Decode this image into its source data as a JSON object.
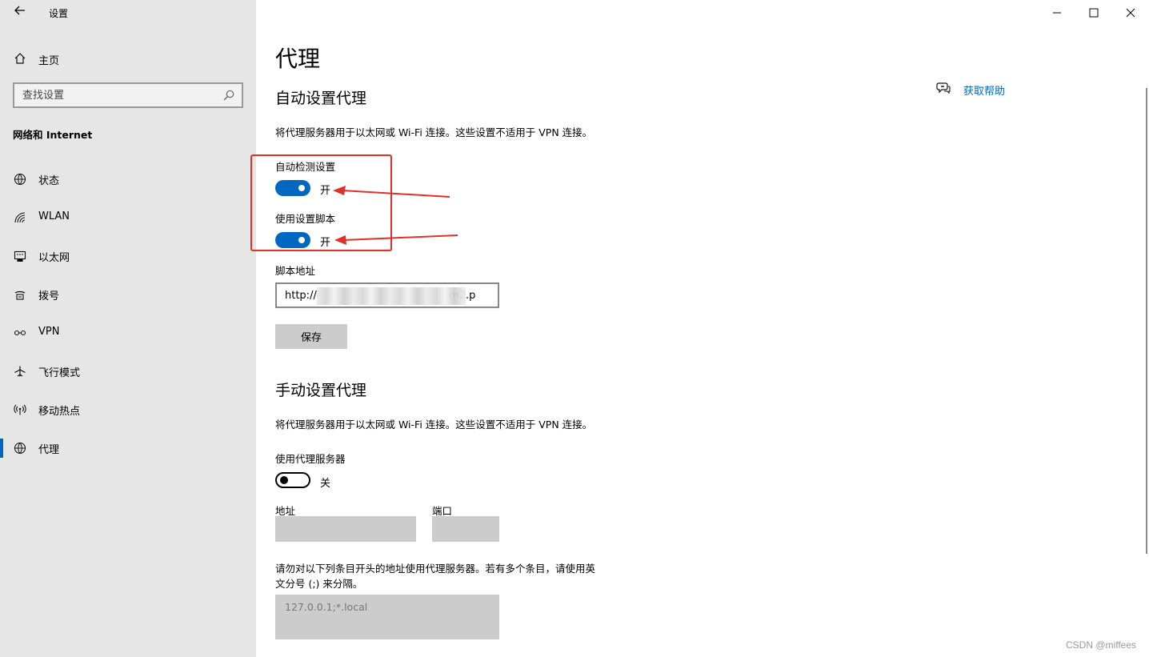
{
  "window": {
    "title": "设置"
  },
  "sidebar": {
    "home_label": "主页",
    "search_placeholder": "查找设置",
    "section_title": "网络和 Internet",
    "items": [
      {
        "label": "状态",
        "icon": "globe-status-icon"
      },
      {
        "label": "WLAN",
        "icon": "wifi-icon"
      },
      {
        "label": "以太网",
        "icon": "ethernet-icon"
      },
      {
        "label": "拨号",
        "icon": "dialup-icon"
      },
      {
        "label": "VPN",
        "icon": "vpn-icon"
      },
      {
        "label": "飞行模式",
        "icon": "airplane-icon"
      },
      {
        "label": "移动热点",
        "icon": "hotspot-icon"
      },
      {
        "label": "代理",
        "icon": "globe-icon",
        "active": true
      }
    ]
  },
  "main": {
    "title": "代理",
    "help_label": "获取帮助",
    "auto": {
      "heading": "自动设置代理",
      "description": "将代理服务器用于以太网或 Wi-Fi 连接。这些设置不适用于 VPN 连接。",
      "detect_label": "自动检测设置",
      "detect_state": "开",
      "script_label": "使用设置脚本",
      "script_state": "开",
      "address_label": "脚本地址",
      "address_value": "http://                                        m2.p",
      "save_label": "保存"
    },
    "manual": {
      "heading": "手动设置代理",
      "description": "将代理服务器用于以太网或 Wi-Fi 连接。这些设置不适用于 VPN 连接。",
      "use_proxy_label": "使用代理服务器",
      "use_proxy_state": "关",
      "address_label": "地址",
      "port_label": "端口",
      "exceptions_text_line1": "请勿对以下列条目开头的地址使用代理服务器。若有多个条目，请使用英",
      "exceptions_text_line2": "文分号 (;) 来分隔。",
      "exceptions_value": "127.0.0.1;*.local"
    }
  },
  "watermark": "CSDN @miffees",
  "colors": {
    "accent": "#0067c0",
    "annotation": "#e0302a",
    "sidebar_bg": "#e6e6e6"
  }
}
